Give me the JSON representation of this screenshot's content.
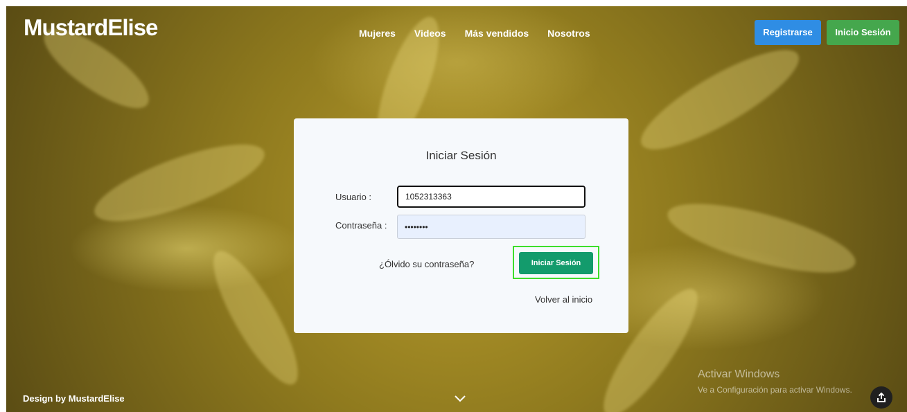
{
  "brand": "MustardElise",
  "nav": {
    "items": [
      {
        "label": "Mujeres"
      },
      {
        "label": "Videos"
      },
      {
        "label": "Más vendidos"
      },
      {
        "label": "Nosotros"
      }
    ]
  },
  "header": {
    "register_label": "Registrarse",
    "login_label": "Inicio Sesión"
  },
  "login": {
    "title": "Iniciar Sesión",
    "user_label": "Usuario :",
    "user_value": "1052313363",
    "pass_label": "Contraseña :",
    "pass_value": "••••••••",
    "forgot_label": "¿Ólvido su contraseña?",
    "submit_label": "Iniciar Sesión",
    "back_label": "Volver al inicio"
  },
  "footer": {
    "credit": "Design by MustardElise"
  },
  "windows_watermark": {
    "line1": "Activar Windows",
    "line2": "Ve a Configuración para activar Windows."
  },
  "colors": {
    "register": "#2f8de4",
    "login": "#45a74d",
    "submit": "#139b6c",
    "focus_outline": "#3dde2b"
  },
  "icons": {
    "scroll": "chevron-down-icon",
    "share": "share-icon"
  }
}
